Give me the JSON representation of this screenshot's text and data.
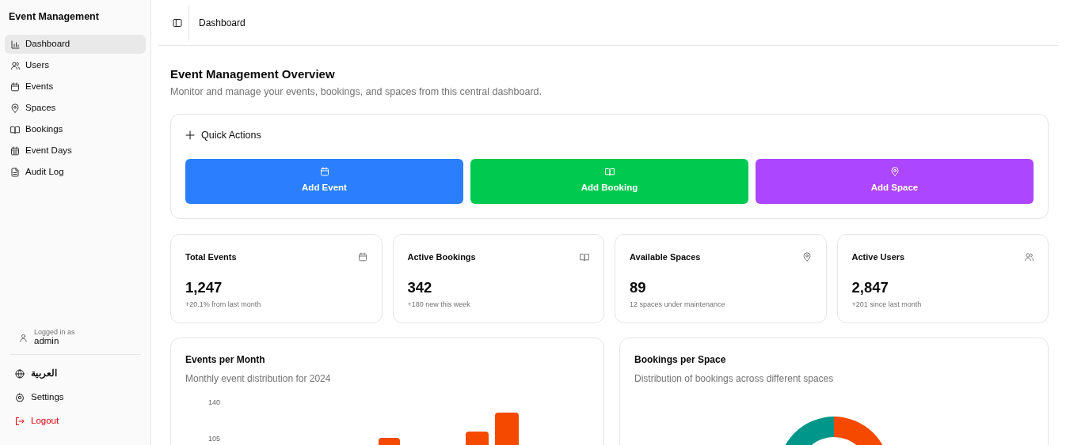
{
  "sidebar": {
    "title": "Event Management",
    "items": [
      {
        "label": "Dashboard",
        "selected": true
      },
      {
        "label": "Users",
        "selected": false
      },
      {
        "label": "Events",
        "selected": false
      },
      {
        "label": "Spaces",
        "selected": false
      },
      {
        "label": "Bookings",
        "selected": false
      },
      {
        "label": "Event Days",
        "selected": false
      },
      {
        "label": "Audit Log",
        "selected": false
      }
    ],
    "user": {
      "caption": "Logged in as",
      "name": "admin"
    },
    "footer": [
      {
        "label": "العربية",
        "kind": "language"
      },
      {
        "label": "Settings",
        "kind": "settings"
      },
      {
        "label": "Logout",
        "kind": "logout"
      }
    ]
  },
  "header": {
    "breadcrumb": "Dashboard"
  },
  "page": {
    "title": "Event Management Overview",
    "subtitle": "Monitor and manage your events, bookings, and spaces from this central dashboard."
  },
  "quick_actions": {
    "title": "Quick Actions",
    "buttons": [
      {
        "label": "Add Event",
        "color": "#2b7fff"
      },
      {
        "label": "Add Booking",
        "color": "#00c950"
      },
      {
        "label": "Add Space",
        "color": "#ad46ff"
      }
    ]
  },
  "stats": [
    {
      "title": "Total Events",
      "value": "1,247",
      "note": "+20.1% from last month"
    },
    {
      "title": "Active Bookings",
      "value": "342",
      "note": "+180 new this week"
    },
    {
      "title": "Available Spaces",
      "value": "89",
      "note": "12 spaces under maintenance"
    },
    {
      "title": "Active Users",
      "value": "2,847",
      "note": "+201 since last month"
    }
  ],
  "charts": [
    {
      "title": "Events per Month",
      "subtitle": "Monthly event distribution for 2024",
      "kind": "bar",
      "y_tick_labels": [
        "140",
        "105"
      ]
    },
    {
      "title": "Bookings per Space",
      "subtitle": "Distribution of bookings across different spaces",
      "kind": "donut"
    }
  ]
}
